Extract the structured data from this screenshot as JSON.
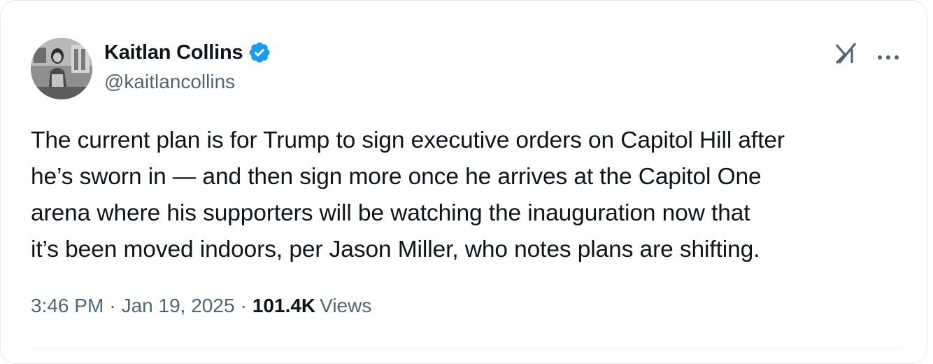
{
  "author": {
    "display_name": "Kaitlan Collins",
    "handle": "@kaitlancollins",
    "verified": true
  },
  "icons": {
    "verified": "verified-badge-icon",
    "grok": "grok-icon",
    "more": "more-options-icon"
  },
  "colors": {
    "verified_blue": "#1d9bf0",
    "text_primary": "#0f1419",
    "text_secondary": "#536471"
  },
  "tweet": {
    "text_lines": [
      "The current plan is for Trump to sign executive orders on Capitol Hill after",
      "he’s sworn in — and then sign more once he arrives at the Capitol One",
      "arena where his supporters will be watching the inauguration now that",
      "it’s been moved indoors, per Jason Miller, who notes plans are shifting."
    ]
  },
  "meta": {
    "time": "3:46 PM",
    "separator": "·",
    "date": "Jan 19, 2025",
    "views_count": "101.4K",
    "views_label": "Views"
  }
}
